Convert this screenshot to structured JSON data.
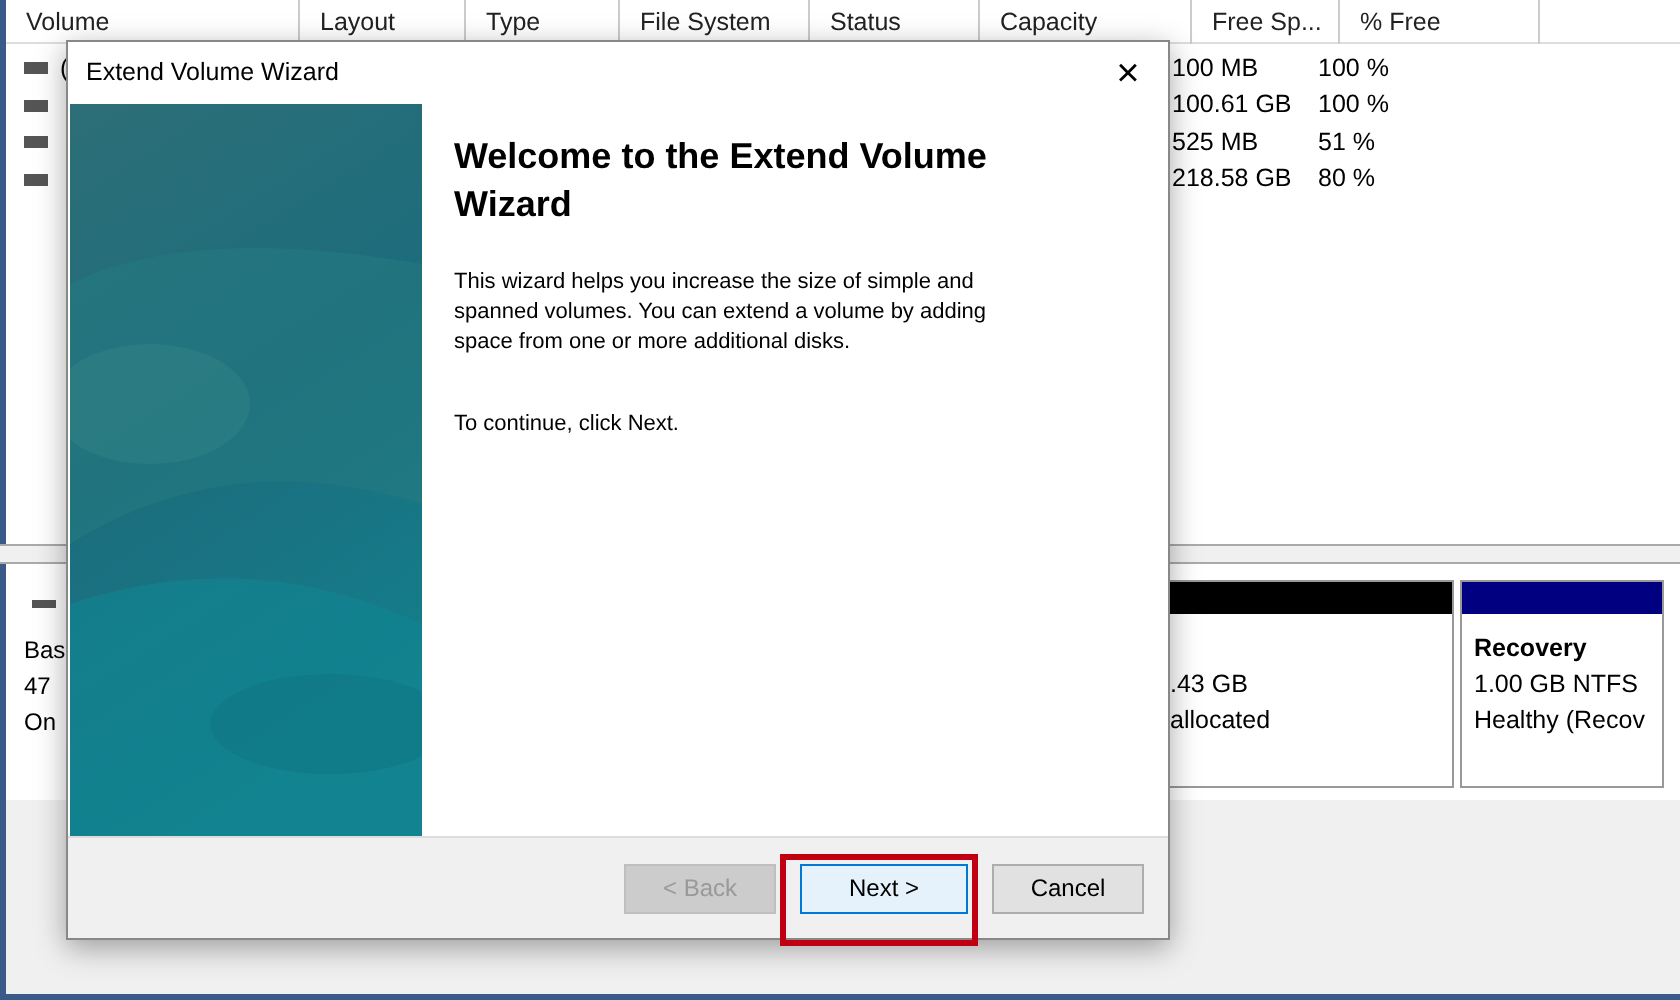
{
  "volume_list": {
    "columns": [
      "Volume",
      "Layout",
      "Type",
      "File System",
      "Status",
      "Capacity",
      "Free Sp...",
      "% Free"
    ],
    "rows": [
      {
        "volume": "(",
        "free_space": "100 MB",
        "percent_free": "100 %"
      },
      {
        "free_space": "100.61 GB",
        "percent_free": "100 %"
      },
      {
        "free_space": "525 MB",
        "percent_free": "51 %"
      },
      {
        "free_space": "218.58 GB",
        "percent_free": "80 %"
      }
    ]
  },
  "disk": {
    "labels": [
      "Bas",
      "47",
      "On"
    ],
    "partitions": [
      {
        "lines": [
          ".43 GB",
          "allocated"
        ],
        "color": "#000000"
      },
      {
        "title": "Recovery",
        "lines": [
          "1.00 GB NTFS",
          "Healthy (Recov"
        ],
        "color": "#000080"
      }
    ]
  },
  "dialog": {
    "title": "Extend Volume Wizard",
    "close": "×",
    "heading": "Welcome to the Extend Volume Wizard",
    "body": "This wizard helps you increase the size of simple and spanned volumes. You can extend a volume  by adding space from one or more additional disks.",
    "hint": "To continue, click Next.",
    "buttons": [
      {
        "label": "< Back",
        "disabled": true,
        "highlighted": false
      },
      {
        "label": "Next >",
        "disabled": false,
        "highlighted": true
      },
      {
        "label": "Cancel",
        "disabled": false,
        "highlighted": false
      }
    ]
  }
}
